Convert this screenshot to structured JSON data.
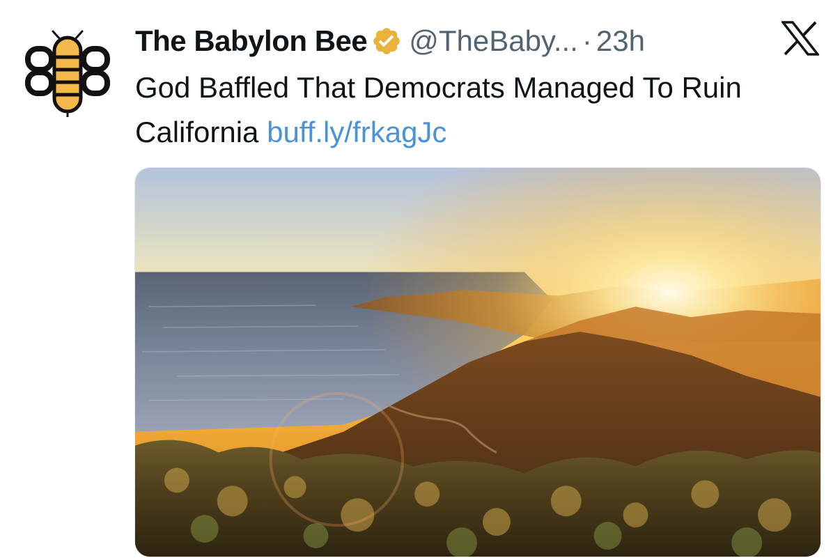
{
  "tweet": {
    "display_name": "The Babylon Bee",
    "handle": "@TheBaby...",
    "separator": "·",
    "timestamp": "23h",
    "text": "God Baffled That Democrats Managed To Ruin California",
    "link_text": "buff.ly/frkagJc",
    "avatar_icon": "bee-logo-icon",
    "verified_badge_icon": "verified-badge-icon",
    "platform_icon": "x-logo-icon",
    "media_description": "sunset-over-coastal-hills-photo"
  },
  "colors": {
    "text_primary": "#0f1419",
    "text_secondary": "#536471",
    "link": "#4a93d9",
    "badge": "#e8b23c",
    "bee_yellow": "#f3b94a"
  }
}
